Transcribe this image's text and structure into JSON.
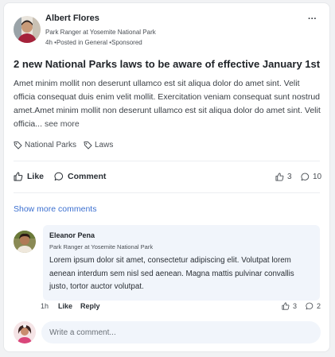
{
  "post": {
    "author": {
      "name": "Albert Flores",
      "role": "Park Ranger at Yosemite National Park"
    },
    "meta": {
      "time": "4h",
      "posted_in": "Posted in General",
      "sponsored": "Sponsored",
      "separator": "•"
    },
    "title": "2 new National Parks laws to be aware of effective January 1st",
    "body": "Amet minim mollit non deserunt ullamco est sit aliqua dolor do amet sint. Velit officia consequat duis enim velit mollit. Exercitation veniam consequat sunt nostrud amet.Amet minim mollit non deserunt ullamco est sit aliqua dolor do amet sint. Velit officia",
    "ellipsis": "...",
    "see_more": "see more",
    "tags": [
      "National Parks",
      "Laws"
    ],
    "actions": {
      "like": "Like",
      "comment": "Comment"
    },
    "like_count": "3",
    "comment_count": "10",
    "more_menu": "···"
  },
  "comments": {
    "show_more": "Show more comments",
    "items": [
      {
        "name": "Eleanor Pena",
        "role": "Park Ranger at Yosemite National Park",
        "text": "Lorem ipsum dolor sit amet, consectetur adipiscing elit. Volutpat lorem aenean interdum sem nisl sed aenean. Magna mattis pulvinar convallis justo, tortor auctor volutpat.",
        "time": "1h",
        "like": "Like",
        "reply": "Reply",
        "like_count": "3",
        "reply_count": "2"
      }
    ]
  },
  "composer": {
    "placeholder": "Write a comment..."
  },
  "colors": {
    "link": "#3b6fd0",
    "bubble": "#f1f5fb"
  }
}
